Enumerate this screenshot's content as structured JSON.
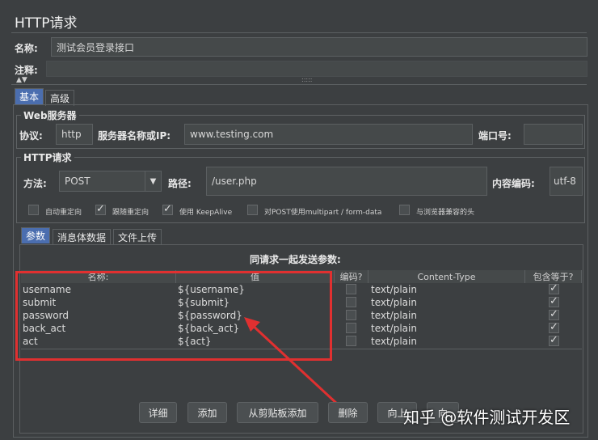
{
  "window_title": "HTTP请求",
  "name_label": "名称:",
  "name_value": "测试会员登录接口",
  "comment_label": "注释:",
  "comment_value": "",
  "collapse_arrows": "▲▼",
  "splitter_grip": ":::::",
  "main_tabs": [
    {
      "label": "基本",
      "active": true
    },
    {
      "label": "高级",
      "active": false
    }
  ],
  "web_server": {
    "legend": "Web服务器",
    "protocol_label": "协议:",
    "protocol_value": "http",
    "server_label": "服务器名称或IP:",
    "server_value": "www.testing.com",
    "port_label": "端口号:",
    "port_value": ""
  },
  "http_request": {
    "legend": "HTTP请求",
    "method_label": "方法:",
    "method_value": "POST",
    "path_label": "路径:",
    "path_value": "/user.php",
    "encoding_label": "内容编码:",
    "encoding_value": "utf-8"
  },
  "options": [
    {
      "label": "自动重定向",
      "checked": false
    },
    {
      "label": "跟随重定向",
      "checked": true
    },
    {
      "label": "使用 KeepAlive",
      "checked": true
    },
    {
      "label": "对POST使用multipart / form-data",
      "checked": false
    },
    {
      "label": "与浏览器兼容的头",
      "checked": false
    }
  ],
  "param_tabs": [
    {
      "label": "参数",
      "active": true
    },
    {
      "label": "消息体数据",
      "active": false
    },
    {
      "label": "文件上传",
      "active": false
    }
  ],
  "params_title": "同请求一起发送参数:",
  "table": {
    "headers": [
      "名称:",
      "值",
      "编码?",
      "Content-Type",
      "包含等于?"
    ],
    "rows": [
      {
        "name": "username",
        "value": "${username}",
        "encode": false,
        "content_type": "text/plain",
        "include_equals": true
      },
      {
        "name": "submit",
        "value": "${submit}",
        "encode": false,
        "content_type": "text/plain",
        "include_equals": true
      },
      {
        "name": "password",
        "value": "${password}",
        "encode": false,
        "content_type": "text/plain",
        "include_equals": true
      },
      {
        "name": "back_act",
        "value": "${back_act}",
        "encode": false,
        "content_type": "text/plain",
        "include_equals": true
      },
      {
        "name": "act",
        "value": "${act}",
        "encode": false,
        "content_type": "text/plain",
        "include_equals": true
      }
    ]
  },
  "buttons": {
    "detail": "详细",
    "add": "添加",
    "add_from_clipboard": "从剪贴板添加",
    "delete": "删除",
    "up": "向上",
    "down": "向"
  },
  "watermark": "知乎 @软件测试开发区",
  "colors": {
    "background": "#3c3f41",
    "annotation_red": "#e03030",
    "active_tab": "#4b6eaf"
  }
}
